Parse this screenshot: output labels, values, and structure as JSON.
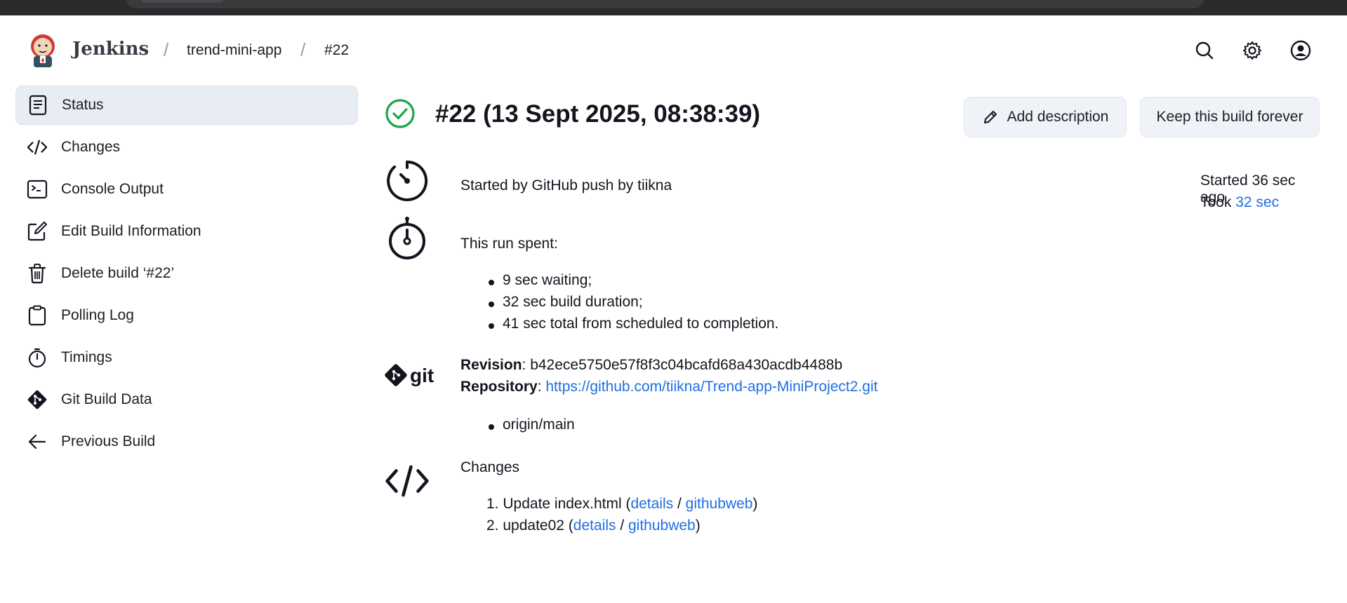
{
  "header": {
    "brand": "Jenkins",
    "breadcrumb": [
      "trend-mini-app",
      "#22"
    ],
    "separator": "/"
  },
  "sidebar": {
    "items": [
      {
        "label": "Status",
        "icon": "document-icon",
        "active": true
      },
      {
        "label": "Changes",
        "icon": "code-icon"
      },
      {
        "label": "Console Output",
        "icon": "terminal-icon"
      },
      {
        "label": "Edit Build Information",
        "icon": "edit-icon"
      },
      {
        "label": "Delete build ‘#22’",
        "icon": "trash-icon"
      },
      {
        "label": "Polling Log",
        "icon": "clipboard-icon"
      },
      {
        "label": "Timings",
        "icon": "stopwatch-icon"
      },
      {
        "label": "Git Build Data",
        "icon": "git-icon"
      },
      {
        "label": "Previous Build",
        "icon": "arrow-left-icon"
      }
    ]
  },
  "main": {
    "title": "#22 (13 Sept 2025, 08:38:39)",
    "status_color": "#1ea446",
    "buttons": {
      "add_description": "Add description",
      "keep_forever": "Keep this build forever"
    },
    "trigger": {
      "text": "Started by GitHub push by tiikna"
    },
    "timing": {
      "started": "Started 36 sec ago",
      "took_label": "Took",
      "took_value": "32 sec"
    },
    "run": {
      "heading": "This run spent:",
      "items": [
        "9 sec waiting;",
        "32 sec build duration;",
        "41 sec total from scheduled to completion."
      ]
    },
    "git": {
      "logo_text": "git",
      "revision_label": "Revision",
      "revision_value": ": b42ece5750e57f8f3c04bcafd68a430acdb4488b",
      "repository_label": "Repository",
      "repository_colon": ": ",
      "repository_url": "https://github.com/tiikna/Trend-app-MiniProject2.git",
      "branches": [
        "origin/main"
      ]
    },
    "changes": {
      "heading": "Changes",
      "items": [
        {
          "num": "1.",
          "text": "Update index.html (",
          "details": "details",
          "slash": " / ",
          "web": "githubweb",
          "close": ")"
        },
        {
          "num": "2.",
          "text": "update02 (",
          "details": "details",
          "slash": " / ",
          "web": "githubweb",
          "close": ")"
        }
      ]
    }
  },
  "colors": {
    "link": "#1f6fe0",
    "active_bg": "#e8ecf3",
    "success": "#1ea446"
  }
}
